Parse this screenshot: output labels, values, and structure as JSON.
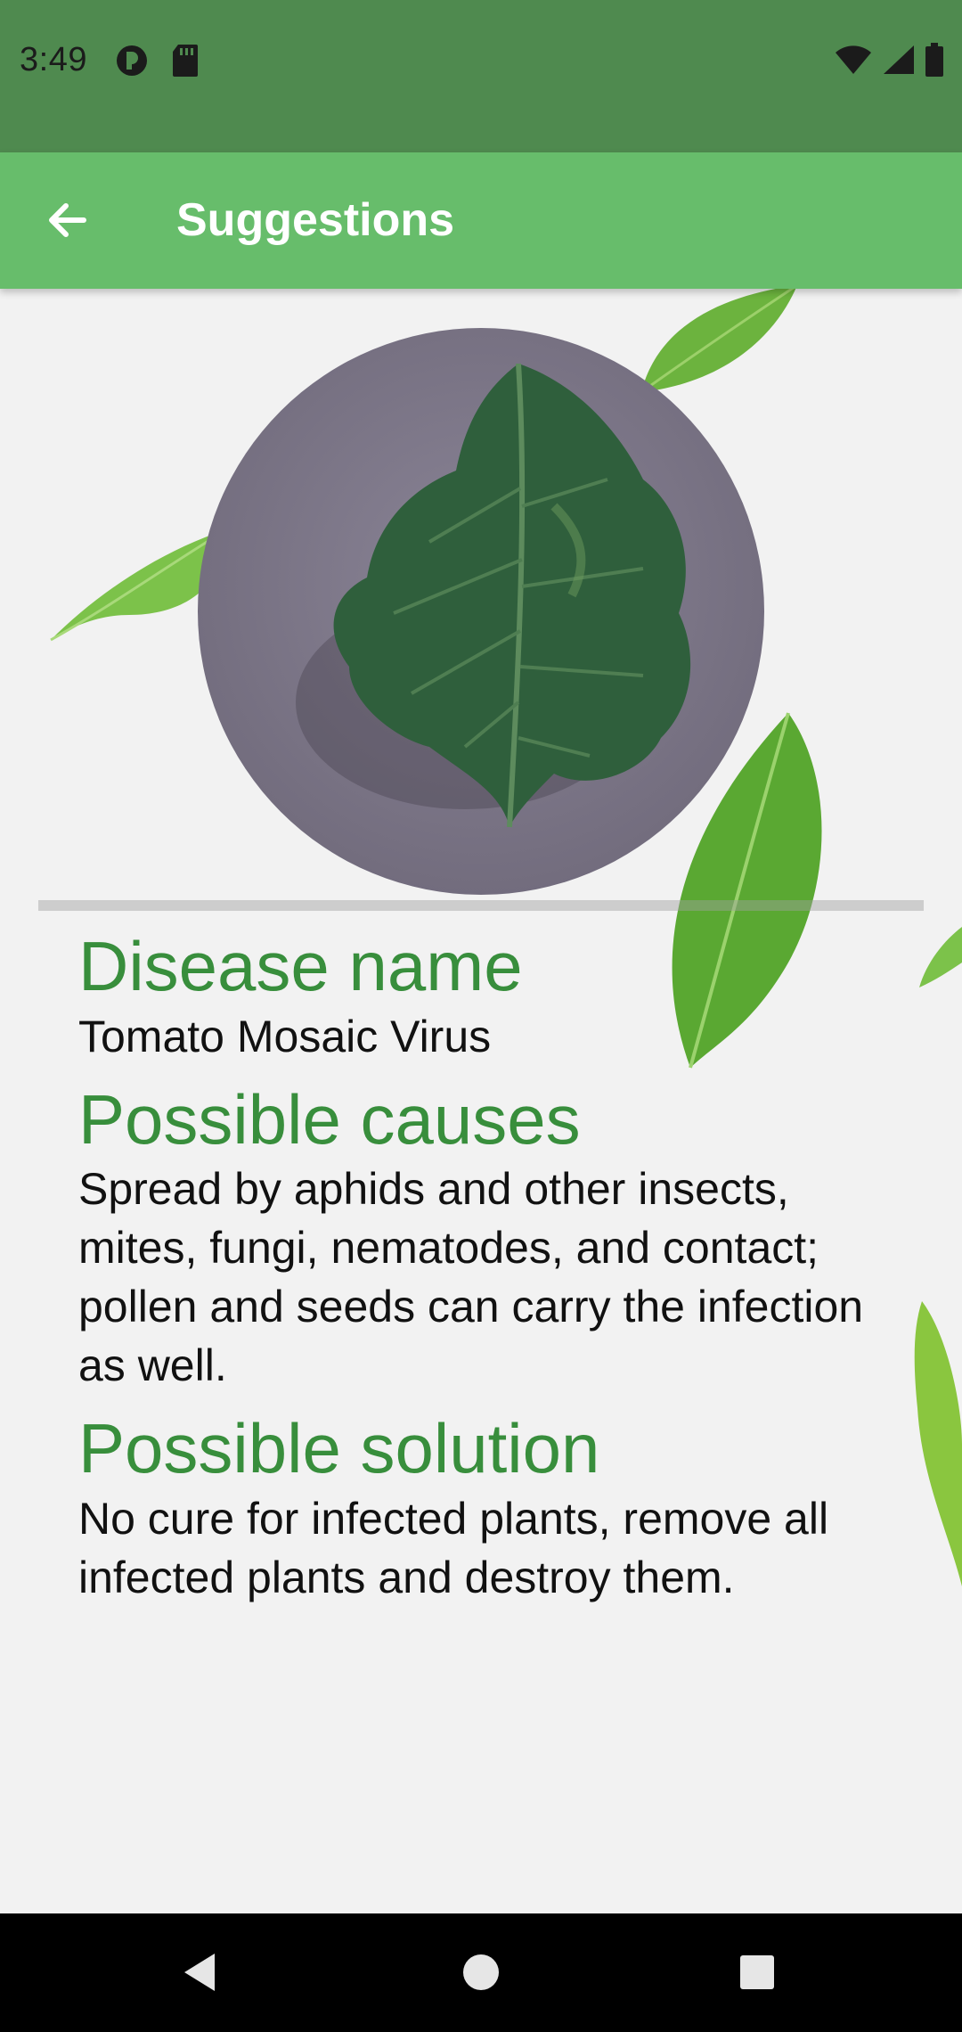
{
  "status_bar": {
    "time": "3:49",
    "left_icons": [
      "data-saver-icon",
      "sd-card-icon"
    ],
    "right_icons": [
      "wifi-icon",
      "signal-icon",
      "battery-icon"
    ]
  },
  "app_bar": {
    "title": "Suggestions",
    "back_icon": "arrow-left-icon"
  },
  "sections": [
    {
      "heading": "Disease name",
      "body": "Tomato Mosaic Virus"
    },
    {
      "heading": "Possible causes",
      "body": "Spread by aphids and other insects, mites, fungi, nematodes, and contact; pollen and seeds can carry the infection as well."
    },
    {
      "heading": "Possible solution",
      "body": "No cure for infected plants, remove all infected plants and destroy them."
    }
  ],
  "nav_bar": {
    "icons": [
      "back-triangle-icon",
      "home-circle-icon",
      "recents-square-icon"
    ]
  },
  "colors": {
    "status_bar": "#4f8a4f",
    "app_bar": "#67bd6b",
    "heading_green": "#388e3c",
    "background": "#f2f2f2"
  }
}
